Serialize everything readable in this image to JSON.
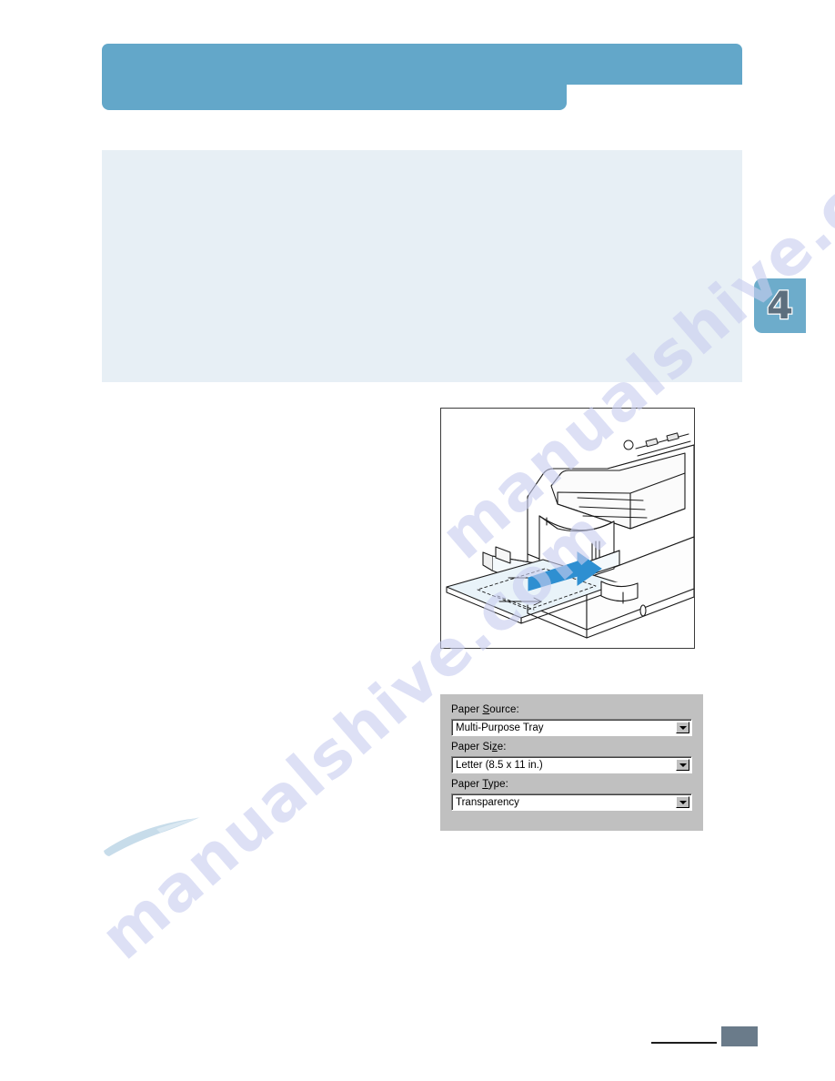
{
  "document": {
    "header": {
      "title": ""
    },
    "note_box": {
      "text": ""
    },
    "chapter_tab": {
      "number": "4"
    },
    "footer": {
      "page_number": ""
    }
  },
  "illustration": {
    "caption": "",
    "alt": "printer-multi-purpose-tray-loading"
  },
  "dialog": {
    "fields": [
      {
        "label_before": "Paper ",
        "label_accel": "S",
        "label_after": "ource:",
        "value": "Multi-Purpose Tray"
      },
      {
        "label_before": "Paper Si",
        "label_accel": "z",
        "label_after": "e:",
        "value": "Letter (8.5 x 11 in.)"
      },
      {
        "label_before": "Paper ",
        "label_accel": "T",
        "label_after": "ype:",
        "value": "Transparency"
      }
    ]
  },
  "watermark": {
    "line_a": "manualshive.com",
    "line_b": "manualshive.com"
  },
  "colors": {
    "band": "#63a7c9",
    "note_box": "#e7eff5",
    "tab": "#6daccb",
    "footer_block": "#6a7b8a",
    "dialog_face": "#c0c0c0",
    "arrow": "#2e8fd1"
  }
}
